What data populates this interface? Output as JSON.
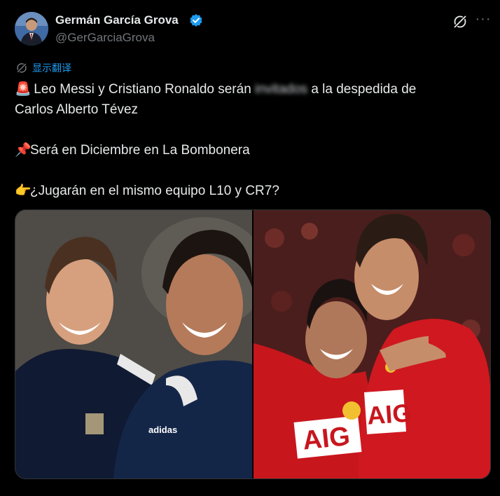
{
  "author": {
    "display_name": "Germán García Grova",
    "handle": "@GerGarciaGrova",
    "verified": true
  },
  "header_icons": {
    "grok": "grok-icon",
    "more": "more-icon",
    "more_label": "···"
  },
  "translate": {
    "icon": "translate-icon",
    "label": "显示翻译"
  },
  "tweet_text": {
    "line1_emoji": "🚨",
    "line1_pre": " Leo Messi y Cristiano Ronaldo serán ",
    "line1_blurred": "invitados",
    "line1_post": " a la despedida de",
    "line2": "Carlos Alberto Tévez",
    "line3_emoji": "📌",
    "line3": "Será en Diciembre en La Bombonera",
    "line4_emoji": "👉",
    "line4": "¿Jugarán en el mismo equipo L10 y CR7?"
  },
  "media": {
    "left_photo": "messi-tevez-argentina-photo",
    "right_photo": "tevez-ronaldo-manchester-united-photo",
    "right_shirt_text_1": "AIG",
    "right_shirt_text_2": "AIG",
    "left_brand": "adidas"
  },
  "colors": {
    "background": "#000000",
    "text": "#e7e9ea",
    "secondary": "#71767b",
    "accent": "#1d9bf0"
  }
}
